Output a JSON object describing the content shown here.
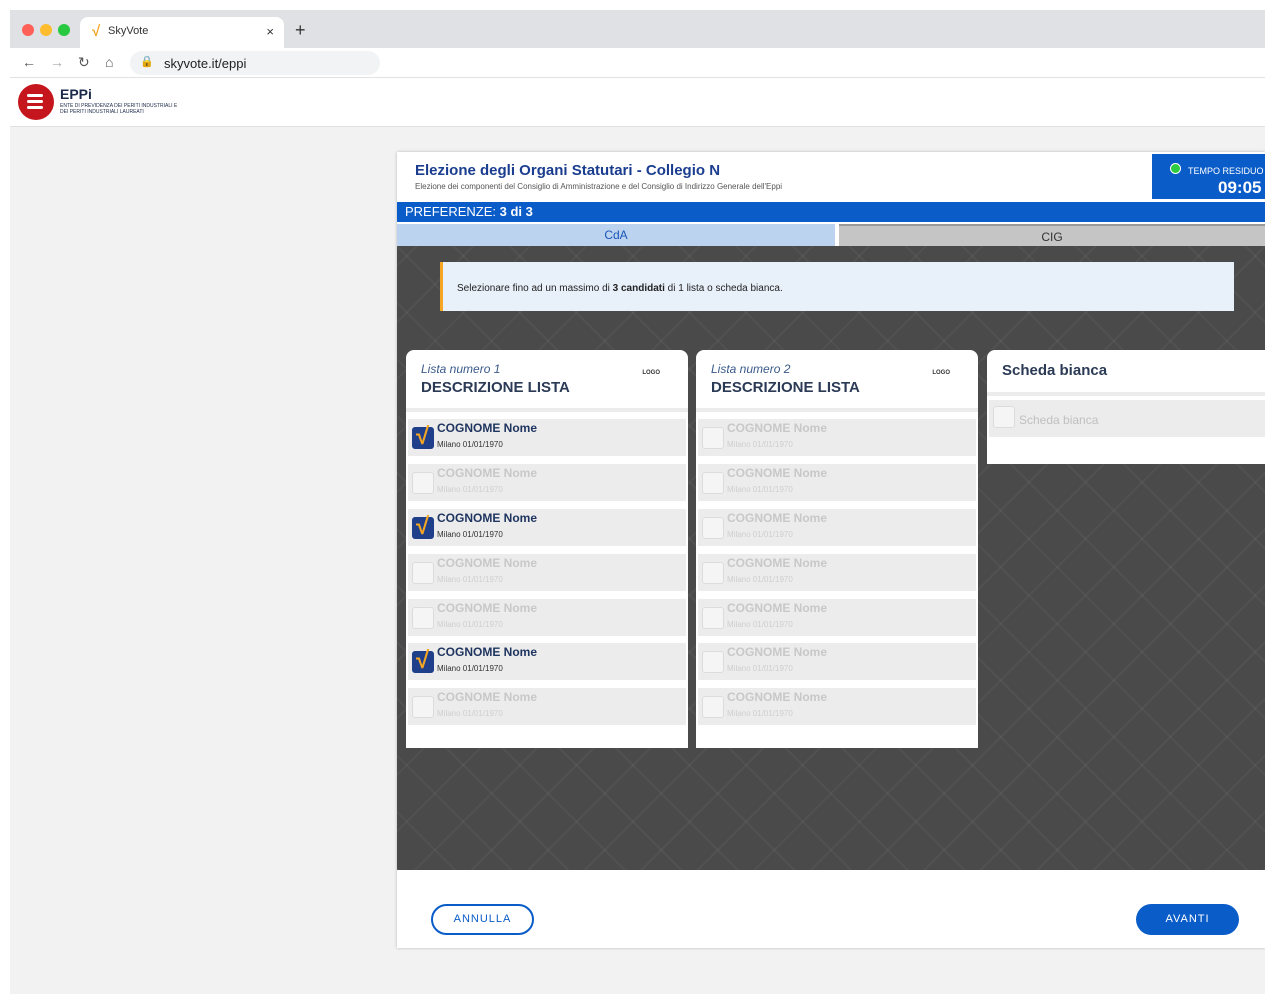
{
  "browser": {
    "tab_title": "SkyVote",
    "tab_favicon": "√",
    "tab_close": "×",
    "new_tab": "+",
    "back": "←",
    "forward": "→",
    "reload": "↻",
    "home": "⌂",
    "lock": "🔒",
    "url": "skyvote.it/eppi"
  },
  "site": {
    "logo_name": "EPPi",
    "logo_sub": "ENTE DI PREVIDENZA DEI PERITI INDUSTRIALI E DEI PERITI INDUSTRIALI LAUREATI"
  },
  "election": {
    "title": "Elezione degli Organi Statutari - Collegio N",
    "subtitle": "Elezione dei componenti del Consiglio di Amministrazione e del Consiglio di Indirizzo Generale dell'Eppi",
    "timer_label": "TEMPO RESIDUO",
    "timer_value": "09:05",
    "pref_label": "PREFERENZE:",
    "pref_value": "3 di 3",
    "tabs": [
      {
        "label": "CdA"
      },
      {
        "label": "CIG"
      }
    ],
    "notice_before": "Selezionare fino ad un massimo di ",
    "notice_bold": "3 candidati",
    "notice_after": " di 1 lista o scheda bianca."
  },
  "lists": [
    {
      "number": "Lista numero 1",
      "description": "DESCRIZIONE LISTA",
      "logo": "LOGO",
      "candidates": [
        {
          "name": "COGNOME Nome",
          "date": "Milano 01/01/1970",
          "selected": true
        },
        {
          "name": "COGNOME Nome",
          "date": "Milano 01/01/1970",
          "selected": false
        },
        {
          "name": "COGNOME Nome",
          "date": "Milano 01/01/1970",
          "selected": true
        },
        {
          "name": "COGNOME Nome",
          "date": "Milano 01/01/1970",
          "selected": false
        },
        {
          "name": "COGNOME Nome",
          "date": "Milano 01/01/1970",
          "selected": false
        },
        {
          "name": "COGNOME Nome",
          "date": "Milano 01/01/1970",
          "selected": true
        },
        {
          "name": "COGNOME Nome",
          "date": "Milano 01/01/1970",
          "selected": false
        }
      ]
    },
    {
      "number": "Lista numero 2",
      "description": "DESCRIZIONE LISTA",
      "logo": "LOGO",
      "candidates": [
        {
          "name": "COGNOME Nome",
          "date": "Milano 01/01/1970",
          "selected": false
        },
        {
          "name": "COGNOME Nome",
          "date": "Milano 01/01/1970",
          "selected": false
        },
        {
          "name": "COGNOME Nome",
          "date": "Milano 01/01/1970",
          "selected": false
        },
        {
          "name": "COGNOME Nome",
          "date": "Milano 01/01/1970",
          "selected": false
        },
        {
          "name": "COGNOME Nome",
          "date": "Milano 01/01/1970",
          "selected": false
        },
        {
          "name": "COGNOME Nome",
          "date": "Milano 01/01/1970",
          "selected": false
        },
        {
          "name": "COGNOME Nome",
          "date": "Milano 01/01/1970",
          "selected": false
        }
      ]
    }
  ],
  "blank": {
    "title": "Scheda bianca",
    "option": "Scheda bianca"
  },
  "actions": {
    "cancel": "ANNULLA",
    "next": "AVANTI"
  },
  "colors": {
    "primary": "#0a5cc8",
    "accent": "#f5a623",
    "brand": "#c4161c"
  }
}
